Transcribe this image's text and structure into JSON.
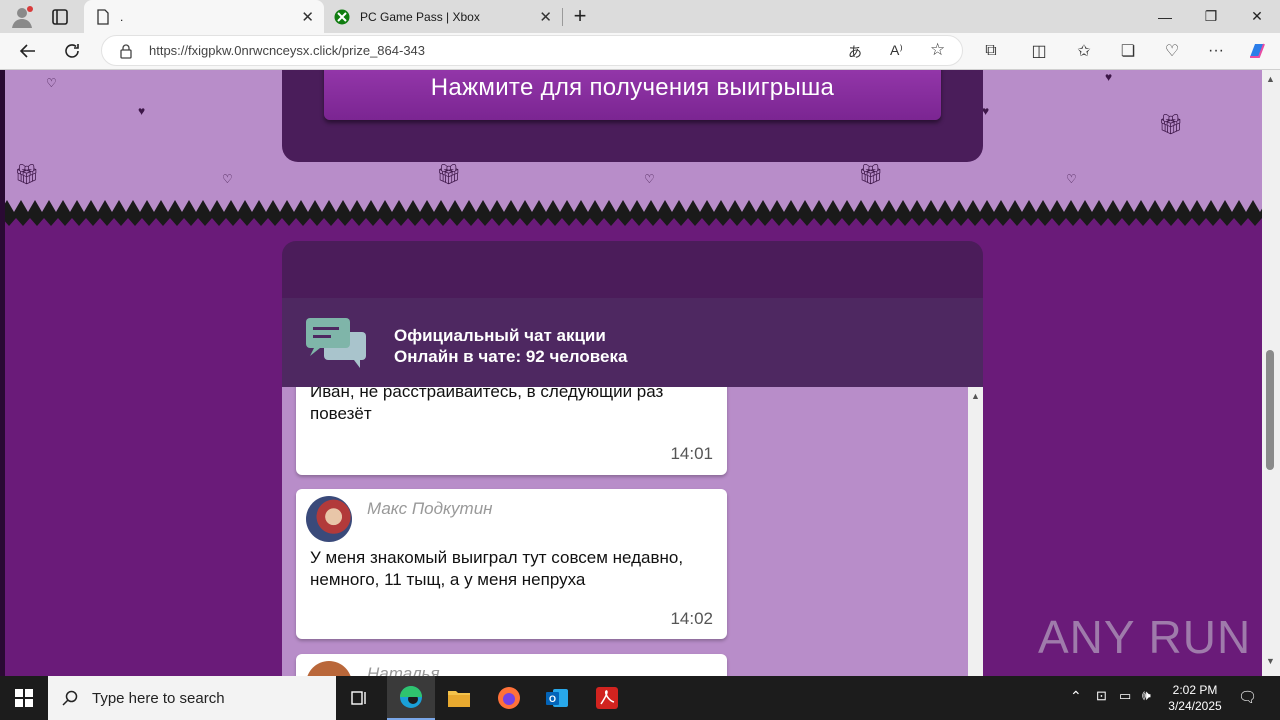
{
  "browser": {
    "tabs": [
      {
        "title": "."
      },
      {
        "title": "PC Game Pass | Xbox"
      }
    ],
    "url": "https://fxigpkw.0nrwcnceysx.click/prize_864-343"
  },
  "page": {
    "prize_button_label": "Нажмите для получения выигрыша",
    "chat": {
      "title": "Официальный чат акции",
      "online": "Онлайн в чате:  92 человека",
      "messages": [
        {
          "author": "",
          "text": "Иван, не расстраивайтесь, в следующий раз повезёт",
          "time": "14:01"
        },
        {
          "author": "Макс Подкутин",
          "text": "У меня знакомый выиграл тут совсем недавно, немного, 11 тыщ, а у меня непруха",
          "time": "14:02"
        },
        {
          "author": "Наталья",
          "text": "",
          "time": ""
        }
      ]
    }
  },
  "watermark": "ANY RUN",
  "taskbar": {
    "search_placeholder": "Type here to search",
    "time": "2:02 PM",
    "date": "3/24/2025"
  },
  "colors": {
    "page_bg": "#6a1b79",
    "band": "#b88dc9",
    "panel": "#4b1c5a",
    "button": "#8e34a5"
  }
}
